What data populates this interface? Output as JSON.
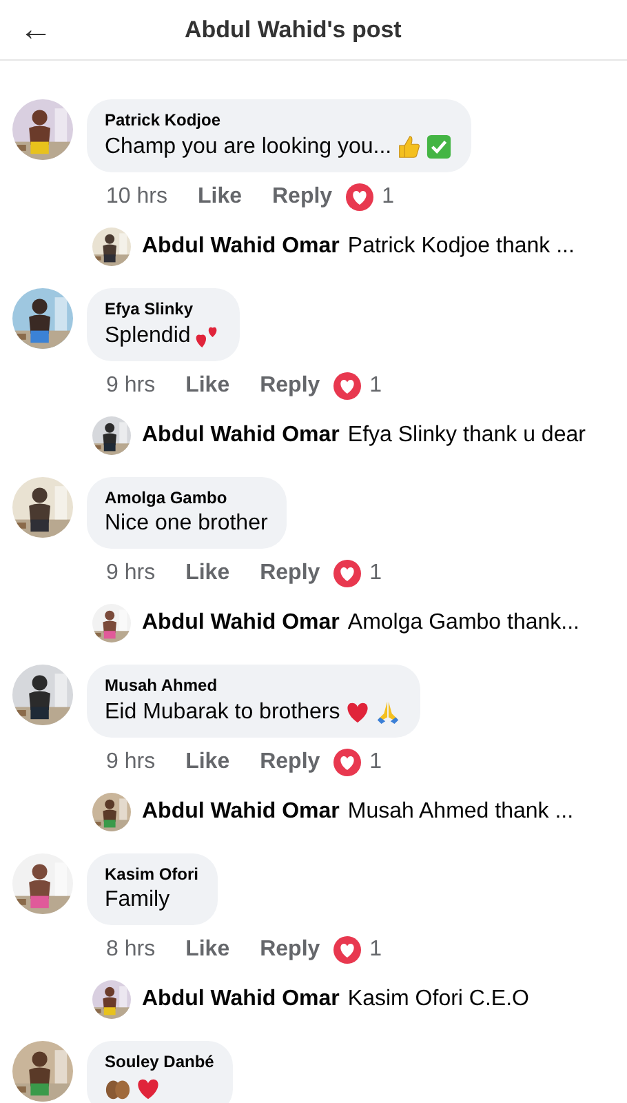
{
  "header": {
    "back": "←",
    "title": "Abdul Wahid's post"
  },
  "comments": [
    {
      "author": "Patrick Kodjoe",
      "text": "Champ you are looking you...",
      "emojis": [
        {
          "kind": "thumbs"
        },
        {
          "kind": "check"
        }
      ],
      "time": "10 hrs",
      "like": "Like",
      "reply": "Reply",
      "reactions": "1",
      "replies": [
        {
          "author": "Abdul Wahid Omar",
          "text": "Patrick Kodjoe thank ..."
        }
      ]
    },
    {
      "author": "Efya Slinky",
      "text": "Splendid",
      "emojis": [
        {
          "kind": "hearts"
        }
      ],
      "time": "9 hrs",
      "like": "Like",
      "reply": "Reply",
      "reactions": "1",
      "replies": [
        {
          "author": "Abdul Wahid Omar",
          "text": "Efya Slinky thank u dear"
        }
      ]
    },
    {
      "author": "Amolga Gambo",
      "text": "Nice one brother",
      "time": "9 hrs",
      "like": "Like",
      "reply": "Reply",
      "reactions": "1",
      "replies": [
        {
          "author": "Abdul Wahid Omar",
          "text": "Amolga Gambo thank..."
        }
      ]
    },
    {
      "author": "Musah Ahmed",
      "text": "Eid Mubarak to brothers",
      "emojis": [
        {
          "kind": "heart"
        },
        {
          "kind": "pray"
        }
      ],
      "time": "9 hrs",
      "like": "Like",
      "reply": "Reply",
      "reactions": "1",
      "replies": [
        {
          "author": "Abdul Wahid Omar",
          "text": "Musah Ahmed thank ..."
        }
      ]
    },
    {
      "author": "Kasim Ofori",
      "text": "Family",
      "time": "8 hrs",
      "like": "Like",
      "reply": "Reply",
      "reactions": "1",
      "replies": [
        {
          "author": "Abdul Wahid Omar",
          "text": "Kasim Ofori C.E.O"
        }
      ]
    },
    {
      "author": "Souley Danbé",
      "emojis": [
        {
          "kind": "clap"
        },
        {
          "kind": "heart"
        }
      ]
    }
  ]
}
